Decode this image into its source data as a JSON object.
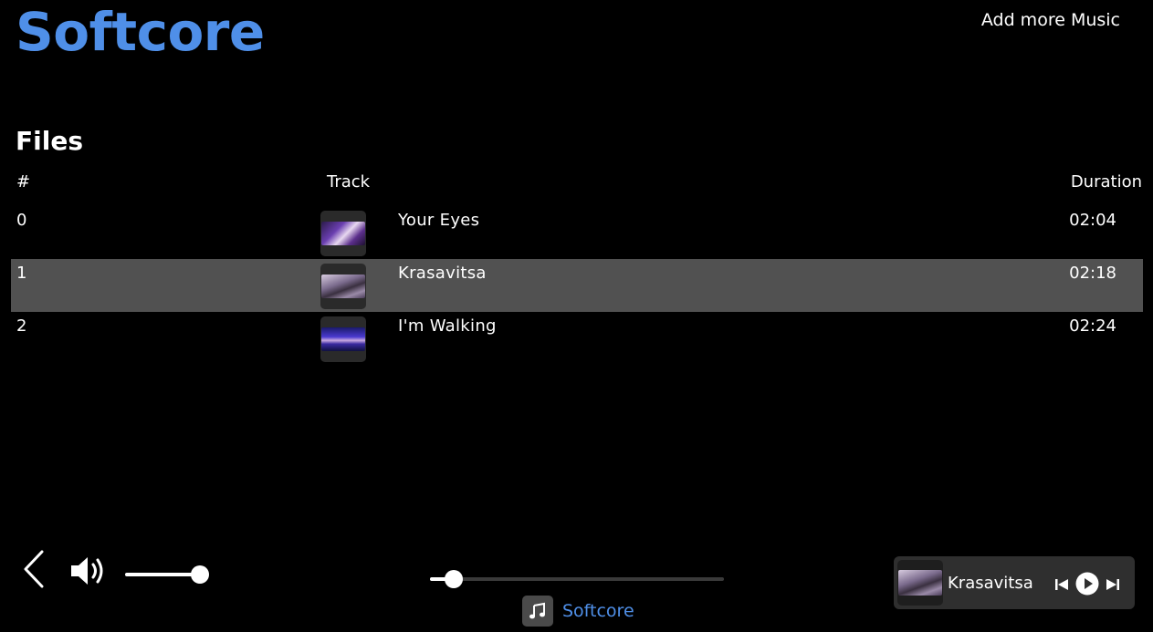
{
  "app": {
    "title": "Softcore"
  },
  "header": {
    "add_music_label": "Add more Music"
  },
  "files": {
    "section_title": "Files",
    "columns": {
      "number": "#",
      "track": "Track",
      "duration": "Duration"
    },
    "rows": [
      {
        "num": "0",
        "title": "Your Eyes",
        "duration": "02:04",
        "selected": false
      },
      {
        "num": "1",
        "title": "Krasavitsa",
        "duration": "02:18",
        "selected": true
      },
      {
        "num": "2",
        "title": "I'm Walking",
        "duration": "02:24",
        "selected": false
      }
    ]
  },
  "player": {
    "volume_level": 0.9,
    "seek_progress": 0.06,
    "playlist_name": "Softcore",
    "now_playing_title": "Krasavitsa",
    "state": "paused"
  },
  "colors": {
    "accent": "#4f8fe8",
    "selected_row": "#515151",
    "background": "#000000"
  },
  "icons": {
    "back": "chevron-left-icon",
    "volume": "speaker-volume-icon",
    "playlist": "music-note-icon",
    "prev": "skip-previous-icon",
    "play": "play-icon",
    "next": "skip-next-icon"
  }
}
